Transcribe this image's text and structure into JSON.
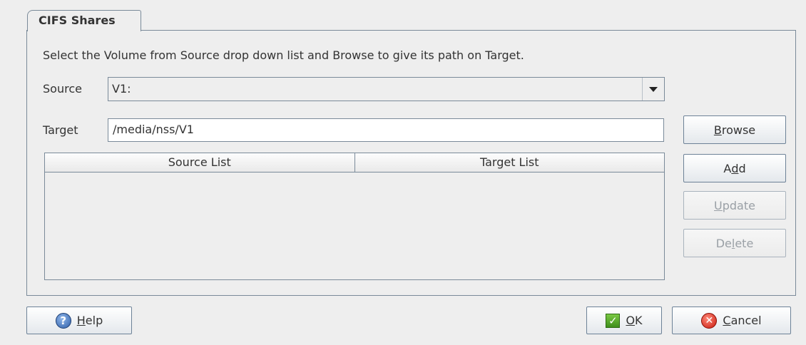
{
  "tab": {
    "label": "CIFS Shares"
  },
  "instructions": "Select the Volume from Source drop down list and Browse to give its path on Target.",
  "source": {
    "label": "Source",
    "value": "V1:"
  },
  "target": {
    "label": "Target",
    "value": "/media/nss/V1"
  },
  "table": {
    "columns": [
      "Source List",
      "Target List"
    ],
    "rows": []
  },
  "buttons": {
    "browse": {
      "pre": "",
      "mn": "B",
      "post": "rowse",
      "enabled": true
    },
    "add": {
      "pre": "A",
      "mn": "d",
      "post": "d",
      "enabled": true
    },
    "update": {
      "pre": "",
      "mn": "U",
      "post": "pdate",
      "enabled": false
    },
    "delete": {
      "pre": "De",
      "mn": "l",
      "post": "ete",
      "enabled": false
    },
    "help": {
      "pre": "",
      "mn": "H",
      "post": "elp",
      "icon": "help-icon"
    },
    "ok": {
      "pre": "",
      "mn": "O",
      "post": "K",
      "icon": "checkmark-icon"
    },
    "cancel": {
      "pre": "",
      "mn": "C",
      "post": "ancel",
      "icon": "cancel-icon"
    }
  }
}
